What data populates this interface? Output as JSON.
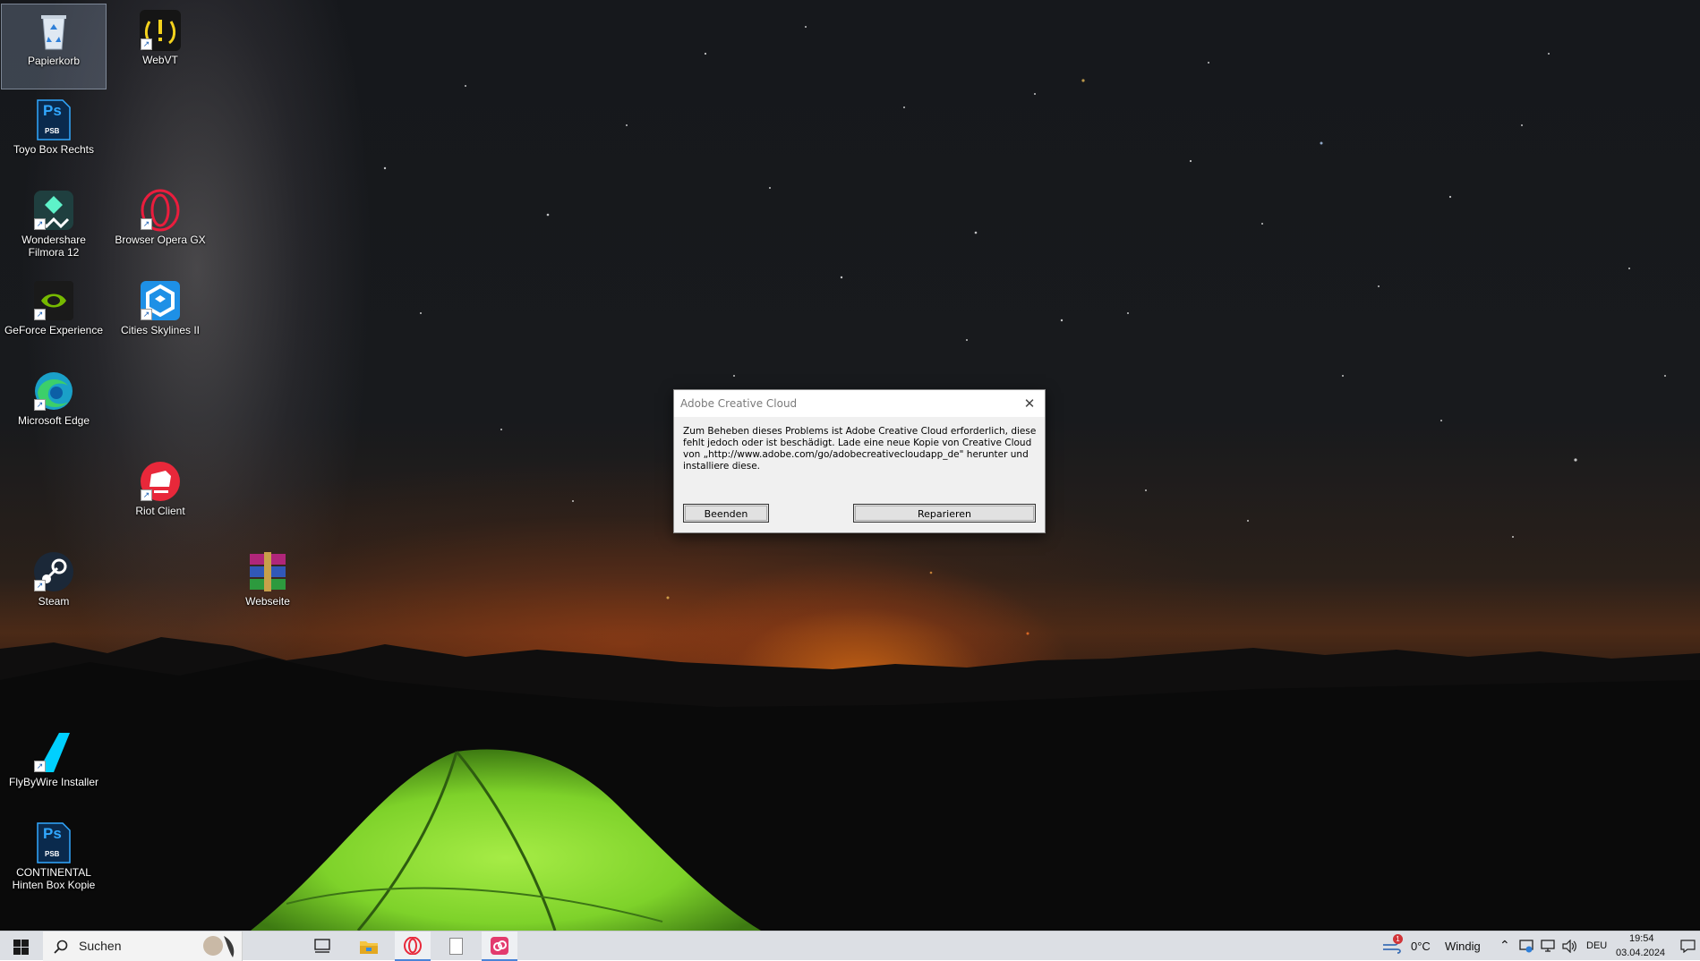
{
  "desktop": {
    "icons": [
      {
        "label": "Papierkorb",
        "icon": "recycle-bin-icon"
      },
      {
        "label": "WebVT",
        "icon": "webvt-icon"
      },
      {
        "label": "Toyo Box Rechts",
        "icon": "photoshop-psb-icon"
      },
      {
        "label": "Wondershare Filmora 12",
        "icon": "filmora-icon"
      },
      {
        "label": "Browser Opera GX",
        "icon": "opera-gx-icon"
      },
      {
        "label": "GeForce Experience",
        "icon": "nvidia-icon"
      },
      {
        "label": "Cities Skylines II",
        "icon": "cities-skylines-icon"
      },
      {
        "label": "Microsoft Edge",
        "icon": "edge-icon"
      },
      {
        "label": "Riot Client",
        "icon": "riot-client-icon"
      },
      {
        "label": "Steam",
        "icon": "steam-icon"
      },
      {
        "label": "Webseite",
        "icon": "winrar-icon"
      },
      {
        "label": "FlyByWire Installer",
        "icon": "flybywire-icon"
      },
      {
        "label": "CONTINENTAL Hinten Box Kopie",
        "icon": "photoshop-psb-icon"
      }
    ],
    "ps_badge": "Ps",
    "psb_badge": "PSB"
  },
  "dialog": {
    "title": "Adobe Creative Cloud",
    "message": "Zum Beheben dieses Problems ist Adobe Creative Cloud erforderlich, diese fehlt jedoch oder ist beschädigt. Lade eine neue Kopie von Creative Cloud von „http://www.adobe.com/go/adobecreativecloudapp_de\" herunter und installiere diese.",
    "quit_label": "Beenden",
    "repair_label": "Reparieren"
  },
  "taskbar": {
    "search_placeholder": "Suchen",
    "pinned": [
      "task-view-icon",
      "file-explorer-icon",
      "opera-icon",
      "notepad-icon",
      "creative-cloud-icon"
    ],
    "weather_temp": "0°C",
    "weather_text": "Windig",
    "weather_badge": "1",
    "language": "DEU",
    "time": "19:54",
    "date": "03.04.2024"
  },
  "colors": {
    "taskbar_bg": "#dcdfe4",
    "dialog_bg": "#f0f0f0",
    "tent_green": "#7ed22a",
    "horizon_orange": "#f07814"
  }
}
